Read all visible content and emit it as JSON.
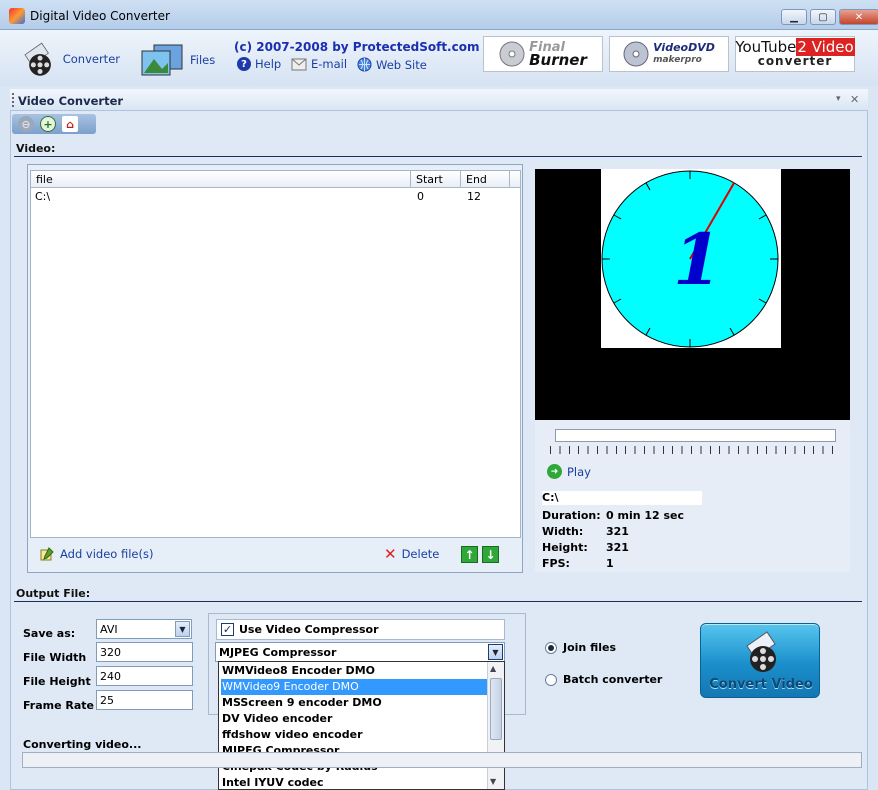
{
  "window": {
    "title": "Digital Video Converter"
  },
  "toolbar": {
    "converter_label": "Converter",
    "files_label": "Files",
    "copyright": "(c) 2007-2008 by ProtectedSoft.com",
    "help_label": "Help",
    "email_label": "E-mail",
    "website_label": "Web Site",
    "banners": [
      {
        "line1": "Final",
        "line2": "Burner"
      },
      {
        "line1": "VideoDVD",
        "line2": "makerpro"
      },
      {
        "line1": "YouTube",
        "line1b": "2 Video",
        "line2": "converter"
      }
    ]
  },
  "panel": {
    "title": "Video Converter"
  },
  "video": {
    "section_label": "Video:",
    "columns": [
      "file",
      "Start",
      "End"
    ],
    "rows": [
      {
        "file": "C:\\",
        "start": "0",
        "end": "12"
      }
    ],
    "add_label": "Add video file(s)",
    "delete_label": "Delete",
    "play_label": "Play",
    "info": {
      "path": "C:\\",
      "duration_label": "Duration:",
      "duration": "0 min 12 sec",
      "width_label": "Width:",
      "width": "321",
      "height_label": "Height:",
      "height": "321",
      "fps_label": "FPS:",
      "fps": "1"
    },
    "preview_digit": "1"
  },
  "output": {
    "section_label": "Output File:",
    "save_as_label": "Save as:",
    "save_as": "AVI",
    "file_width_label": "File Width",
    "file_width": "320",
    "file_height_label": "File Height",
    "file_height": "240",
    "frame_rate_label": "Frame Rate",
    "frame_rate": "25",
    "use_compressor_label": "Use Video Compressor",
    "compressor_selected": "MJPEG Compressor",
    "compressor_options": [
      "WMVideo8 Encoder DMO",
      "WMVideo9 Encoder DMO",
      "MSScreen 9 encoder DMO",
      "DV Video encoder",
      "ffdshow video encoder",
      "MJPEG Compressor",
      "Cinepak Codec by Radius",
      "Intel IYUV codec"
    ],
    "join_label": "Join files",
    "batch_label": "Batch converter",
    "convert_label": "Convert Video",
    "status": "Converting video..."
  },
  "colors": {
    "accent": "#1b3fa0",
    "preview_face": "#00ffff",
    "selection": "#3399ff"
  }
}
